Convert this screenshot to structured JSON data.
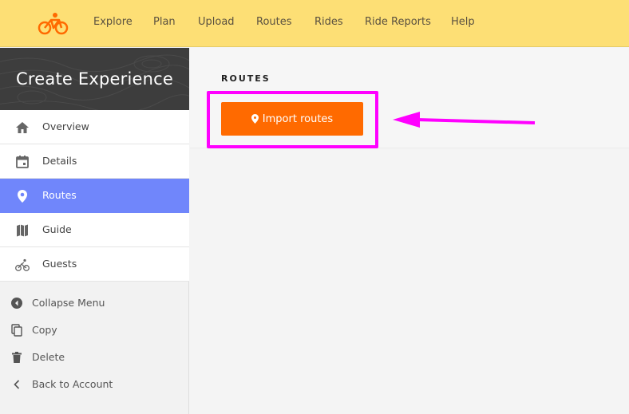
{
  "brand": {
    "logo_icon": "bicycle-logo-icon",
    "color": "#ff6a00"
  },
  "nav": {
    "items": [
      {
        "label": "Explore"
      },
      {
        "label": "Plan"
      },
      {
        "label": "Upload"
      },
      {
        "label": "Routes"
      },
      {
        "label": "Rides"
      },
      {
        "label": "Ride Reports"
      },
      {
        "label": "Help"
      }
    ]
  },
  "sidebar": {
    "title": "Create Experience",
    "items": [
      {
        "label": "Overview",
        "icon": "home-icon",
        "active": false
      },
      {
        "label": "Details",
        "icon": "calendar-icon",
        "active": false
      },
      {
        "label": "Routes",
        "icon": "map-pin-icon",
        "active": true
      },
      {
        "label": "Guide",
        "icon": "map-icon",
        "active": false
      },
      {
        "label": "Guests",
        "icon": "cyclist-icon",
        "active": false
      }
    ],
    "actions": [
      {
        "label": "Collapse Menu",
        "icon": "collapse-icon"
      },
      {
        "label": "Copy",
        "icon": "copy-icon"
      },
      {
        "label": "Delete",
        "icon": "trash-icon"
      },
      {
        "label": "Back to Account",
        "icon": "chevron-left-icon"
      }
    ]
  },
  "main": {
    "section_title": "ROUTES",
    "import_button": {
      "label": "Import routes",
      "icon": "map-pin-icon"
    }
  },
  "annotation": {
    "highlight_color": "#ff00ff",
    "arrow_icon": "arrow-left-icon"
  },
  "colors": {
    "topbar": "#fddf75",
    "active_item": "#7086fb",
    "button": "#ff6a00"
  }
}
